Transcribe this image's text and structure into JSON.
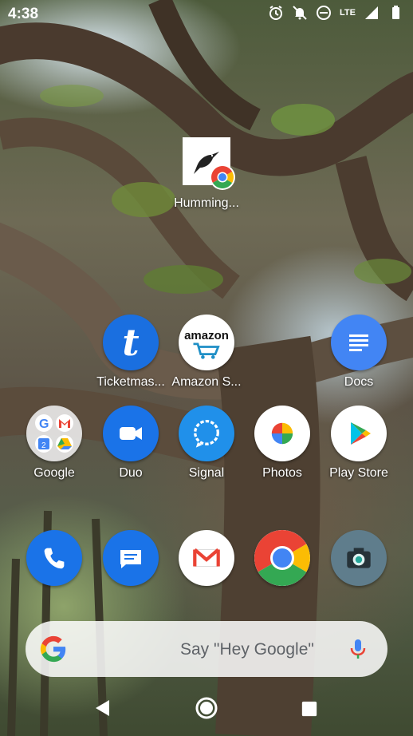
{
  "status_bar": {
    "time": "4:38",
    "network": "LTE"
  },
  "shortcut": {
    "label": "Humming..."
  },
  "apps_row1": [
    {
      "label": "Ticketmas..."
    },
    {
      "label": "Amazon S..."
    },
    {
      "label": "Docs"
    }
  ],
  "apps_row2": [
    {
      "label": "Google"
    },
    {
      "label": "Duo"
    },
    {
      "label": "Signal"
    },
    {
      "label": "Photos"
    },
    {
      "label": "Play Store"
    }
  ],
  "dock": [
    {
      "name": "phone-icon"
    },
    {
      "name": "messages-icon"
    },
    {
      "name": "gmail-icon"
    },
    {
      "name": "chrome-icon"
    },
    {
      "name": "camera-icon"
    }
  ],
  "search": {
    "hint": "Say \"Hey Google\""
  },
  "colors": {
    "blue": "#1a73e8",
    "docs_blue": "#4285f4",
    "signal_blue": "#2090ea",
    "red": "#ea4335",
    "yellow": "#fbbc04",
    "green": "#34a853"
  }
}
